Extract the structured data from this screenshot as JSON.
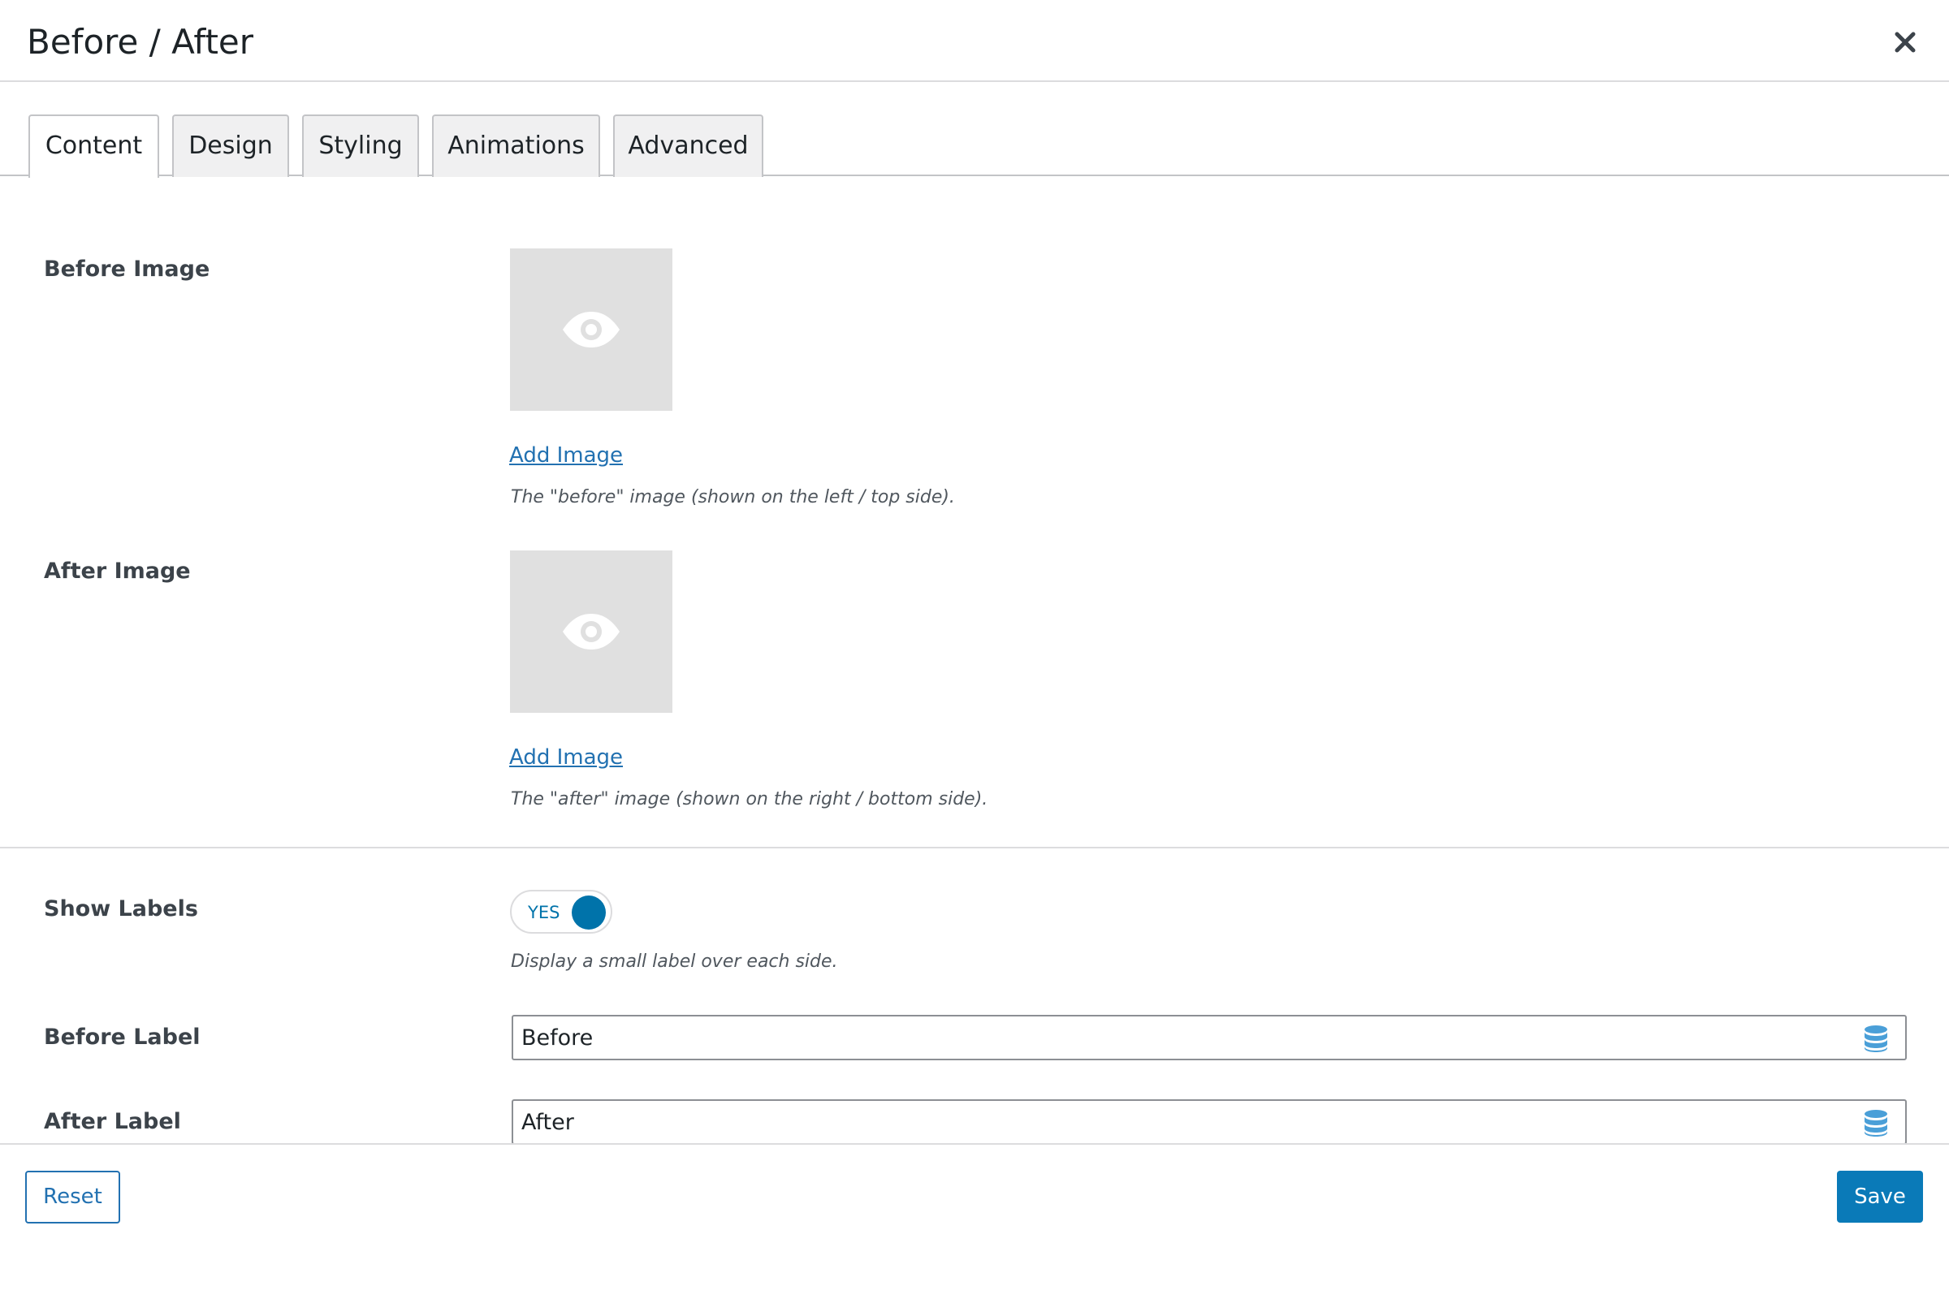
{
  "dialog": {
    "title": "Before / After"
  },
  "tabs": [
    {
      "label": "Content",
      "active": true
    },
    {
      "label": "Design",
      "active": false
    },
    {
      "label": "Styling",
      "active": false
    },
    {
      "label": "Animations",
      "active": false
    },
    {
      "label": "Advanced",
      "active": false
    }
  ],
  "fields": {
    "before_image": {
      "label": "Before Image",
      "placeholder_icon": "eye-icon",
      "add_link": "Add Image",
      "help": "The \"before\" image (shown on the left / top side)."
    },
    "after_image": {
      "label": "After Image",
      "placeholder_icon": "eye-icon",
      "add_link": "Add Image",
      "help": "The \"after\" image (shown on the right / bottom side)."
    },
    "show_labels": {
      "label": "Show Labels",
      "toggle_text": "YES",
      "value": true,
      "help": "Display a small label over each side."
    },
    "before_label": {
      "label": "Before Label",
      "value": "Before",
      "icon": "database-icon"
    },
    "after_label": {
      "label": "After Label",
      "value": "After",
      "icon": "database-icon"
    }
  },
  "footer": {
    "reset_label": "Reset",
    "save_label": "Save"
  },
  "colors": {
    "accent": "#0073aa",
    "link": "#2271b1",
    "save_bg": "#0a7ab8"
  }
}
